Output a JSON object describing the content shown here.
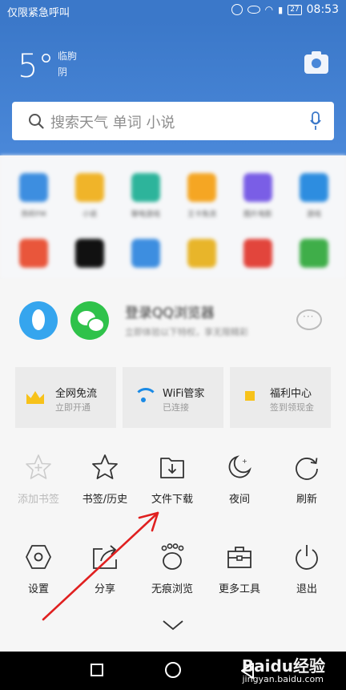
{
  "status_bar": {
    "left_text": "仅限紧急呼叫",
    "battery": "27",
    "time": "08:53"
  },
  "weather": {
    "temperature": "5°",
    "location": "临朐",
    "condition": "阴"
  },
  "search": {
    "placeholder": "搜索天气 单词 小说"
  },
  "background_grid": {
    "captions": [
      "热听FM",
      "小说",
      "聊电游戏",
      "王卡免流",
      "图片电影",
      "游戏"
    ]
  },
  "login": {
    "title": "登录QQ浏览器",
    "subtitle": "立即体验以下特权，享无限精彩"
  },
  "services": [
    {
      "title": "全网免流",
      "subtitle": "立即开通",
      "icon": "crown-icon"
    },
    {
      "title": "WiFi管家",
      "subtitle": "已连接",
      "icon": "wifi-icon"
    },
    {
      "title": "福利中心",
      "subtitle": "签到领现金",
      "icon": "gift-icon"
    }
  ],
  "menu_row1": [
    {
      "label": "添加书签",
      "icon": "add-bookmark-icon",
      "disabled": true
    },
    {
      "label": "书签/历史",
      "icon": "star-icon"
    },
    {
      "label": "文件下载",
      "icon": "download-folder-icon"
    },
    {
      "label": "夜间",
      "icon": "moon-icon"
    },
    {
      "label": "刷新",
      "icon": "refresh-icon"
    }
  ],
  "menu_row2": [
    {
      "label": "设置",
      "icon": "settings-hexagon-icon"
    },
    {
      "label": "分享",
      "icon": "share-icon"
    },
    {
      "label": "无痕浏览",
      "icon": "incognito-paw-icon"
    },
    {
      "label": "更多工具",
      "icon": "toolbox-icon"
    },
    {
      "label": "退出",
      "icon": "power-icon"
    }
  ],
  "watermark": {
    "brand": "Baidu经验",
    "url": "jingyan.baidu.com"
  },
  "colors": {
    "header_blue": "#3b78c9",
    "annotation_red": "#e02020",
    "qq_blue": "#35a5ee",
    "wechat_green": "#2fc24a"
  }
}
